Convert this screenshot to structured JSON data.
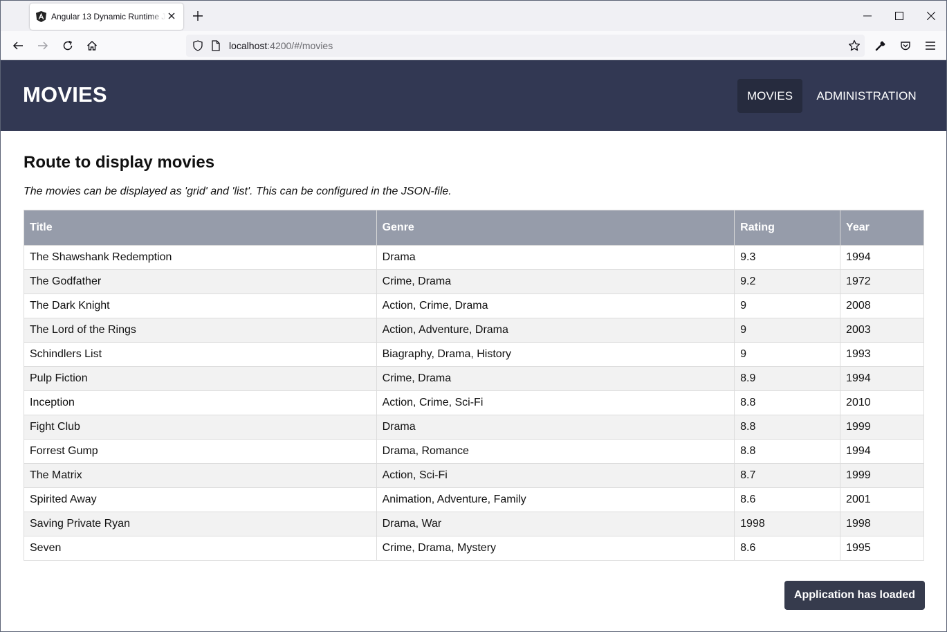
{
  "browser": {
    "tab_title": "Angular 13 Dynamic Runtime JSON",
    "url_host": "localhost",
    "url_rest": ":4200/#/movies"
  },
  "app": {
    "title": "MOVIES",
    "nav": [
      {
        "label": "MOVIES",
        "active": true
      },
      {
        "label": "ADMINISTRATION",
        "active": false
      }
    ]
  },
  "content": {
    "heading": "Route to display movies",
    "description": "The movies can be displayed as 'grid' and 'list'. This can be configured in the JSON-file."
  },
  "table": {
    "headers": [
      "Title",
      "Genre",
      "Rating",
      "Year"
    ],
    "rows": [
      [
        "The Shawshank Redemption",
        "Drama",
        "9.3",
        "1994"
      ],
      [
        "The Godfather",
        "Crime, Drama",
        "9.2",
        "1972"
      ],
      [
        "The Dark Knight",
        "Action, Crime, Drama",
        "9",
        "2008"
      ],
      [
        "The Lord of the Rings",
        "Action, Adventure, Drama",
        "9",
        "2003"
      ],
      [
        "Schindlers List",
        "Biagraphy, Drama, History",
        "9",
        "1993"
      ],
      [
        "Pulp Fiction",
        "Crime, Drama",
        "8.9",
        "1994"
      ],
      [
        "Inception",
        "Action, Crime, Sci-Fi",
        "8.8",
        "2010"
      ],
      [
        "Fight Club",
        "Drama",
        "8.8",
        "1999"
      ],
      [
        "Forrest Gump",
        "Drama, Romance",
        "8.8",
        "1994"
      ],
      [
        "The Matrix",
        "Action, Sci-Fi",
        "8.7",
        "1999"
      ],
      [
        "Spirited Away",
        "Animation, Adventure, Family",
        "8.6",
        "2001"
      ],
      [
        "Saving Private Ryan",
        "Drama, War",
        "1998",
        "1998"
      ],
      [
        "Seven",
        "Crime, Drama, Mystery",
        "8.6",
        "1995"
      ]
    ]
  },
  "status": {
    "label": "Application has loaded"
  },
  "icons": {
    "back": "back-arrow-icon",
    "forward": "forward-arrow-icon",
    "reload": "reload-icon",
    "home": "home-icon",
    "star": "bookmark-star-icon",
    "wrench": "wrench-icon",
    "pocket": "pocket-icon",
    "menu": "hamburger-menu-icon"
  },
  "colors": {
    "header_bg": "#323853",
    "nav_active_bg": "#262b3e",
    "table_header_bg": "#969caa",
    "badge_bg": "#363b4d"
  }
}
